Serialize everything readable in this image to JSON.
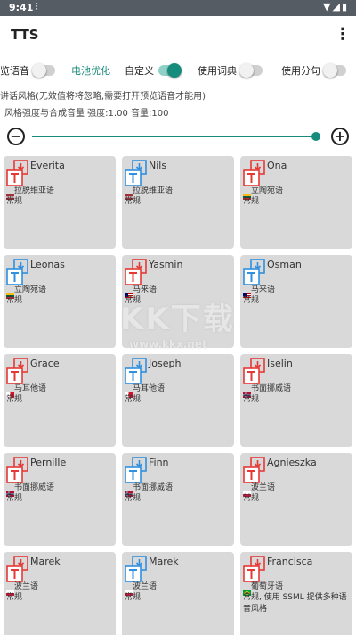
{
  "status_bar": {
    "time": "9:41",
    "vibrate_icon": "vibrate-icon",
    "icons": [
      "wifi-icon",
      "signal-icon",
      "battery-icon"
    ]
  },
  "appbar": {
    "title": "TTS",
    "menu_icon": "more-vert-icon"
  },
  "toggles": [
    {
      "label": "览语音",
      "on": false,
      "accent": false
    },
    {
      "label": "电池优化",
      "on": null,
      "accent": true
    },
    {
      "label": "自定义",
      "on": true,
      "accent": false
    },
    {
      "label": "使用词典",
      "on": false,
      "accent": false
    },
    {
      "label": "使用分句",
      "on": false,
      "accent": false
    }
  ],
  "description": "讲话风格(无效值将将忽略,需要打开预览语音才能用)",
  "strength_line": "风格强度与合成音量   强度:1.00 音量:100",
  "slider": {
    "value_fraction": 0.99,
    "minus_icon": "minus-circle-icon",
    "plus_icon": "plus-circle-icon"
  },
  "colors": {
    "accent": "#168c7c",
    "red_icon": "#e53935",
    "blue_icon": "#2f8fe0",
    "card_bg": "#d9d9d9",
    "status_bar": "#555c64"
  },
  "watermark": {
    "line1": "KK下载",
    "line2": "www.kkx.net"
  },
  "voices": [
    {
      "name": "Everita",
      "lang": "拉脱维亚语",
      "style": "常规",
      "icon_color": "red",
      "flag": "latvia"
    },
    {
      "name": "Nils",
      "lang": "拉脱维亚语",
      "style": "常规",
      "icon_color": "blue",
      "flag": "latvia"
    },
    {
      "name": "Ona",
      "lang": "立陶宛语",
      "style": "常规",
      "icon_color": "red",
      "flag": "lithuania"
    },
    {
      "name": "Leonas",
      "lang": "立陶宛语",
      "style": "常规",
      "icon_color": "blue",
      "flag": "lithuania"
    },
    {
      "name": "Yasmin",
      "lang": "马来语",
      "style": "常规",
      "icon_color": "red",
      "flag": "malaysia"
    },
    {
      "name": "Osman",
      "lang": "马来语",
      "style": "常规",
      "icon_color": "blue",
      "flag": "malaysia"
    },
    {
      "name": "Grace",
      "lang": "马耳他语",
      "style": "常规",
      "icon_color": "red",
      "flag": "malta"
    },
    {
      "name": "Joseph",
      "lang": "马耳他语",
      "style": "常规",
      "icon_color": "blue",
      "flag": "malta"
    },
    {
      "name": "Iselin",
      "lang": "书面挪威语",
      "style": "常规",
      "icon_color": "red",
      "flag": "norway"
    },
    {
      "name": "Pernille",
      "lang": "书面挪威语",
      "style": "常规",
      "icon_color": "red",
      "flag": "norway"
    },
    {
      "name": "Finn",
      "lang": "书面挪威语",
      "style": "常规",
      "icon_color": "blue",
      "flag": "norway"
    },
    {
      "name": "Agnieszka",
      "lang": "波兰语",
      "style": "常规",
      "icon_color": "red",
      "flag": "poland"
    },
    {
      "name": "Marek",
      "lang": "波兰语",
      "style": "常规",
      "icon_color": "red",
      "flag": "poland"
    },
    {
      "name": "Marek",
      "lang": "波兰语",
      "style": "常规",
      "icon_color": "blue",
      "flag": "poland"
    },
    {
      "name": "Francisca",
      "lang": "葡萄牙语",
      "style": "常规, 使用 SSML 提供多种语音风格",
      "icon_color": "red",
      "flag": "brazil"
    }
  ]
}
